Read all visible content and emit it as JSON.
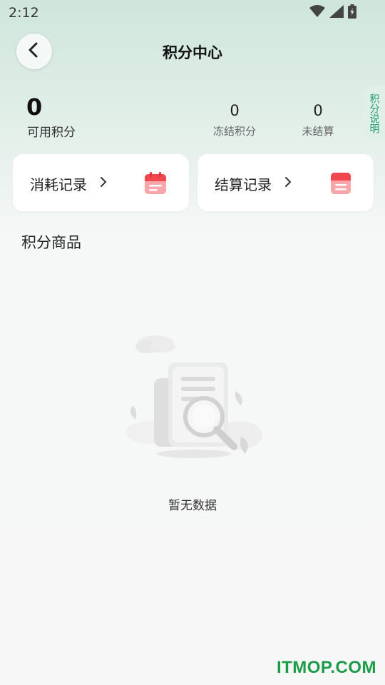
{
  "status_bar": {
    "time": "2:12",
    "icons": [
      "wifi-icon",
      "signal-icon",
      "battery-icon"
    ]
  },
  "header": {
    "back_icon": "chevron-left-icon",
    "title": "积分中心"
  },
  "summary": {
    "available_value": "0",
    "available_label": "可用积分",
    "frozen_value": "0",
    "frozen_label": "冻结积分",
    "unsettled_value": "0",
    "unsettled_label": "未结算"
  },
  "explain_tab": {
    "label": "积分说明"
  },
  "cards": {
    "consumption": {
      "label": "消耗记录",
      "chevron": ">",
      "icon": "calendar-icon"
    },
    "settlement": {
      "label": "结算记录",
      "chevron": ">",
      "icon": "document-icon"
    }
  },
  "products": {
    "title": "积分商品",
    "empty_text": "暂无数据",
    "empty_icon": "empty-document-search-icon"
  },
  "watermark": {
    "text": "ITMOP.COM"
  },
  "colors": {
    "accent_green": "#27a06f",
    "icon_red": "#f2575e",
    "watermark_green": "#1c9b48"
  }
}
